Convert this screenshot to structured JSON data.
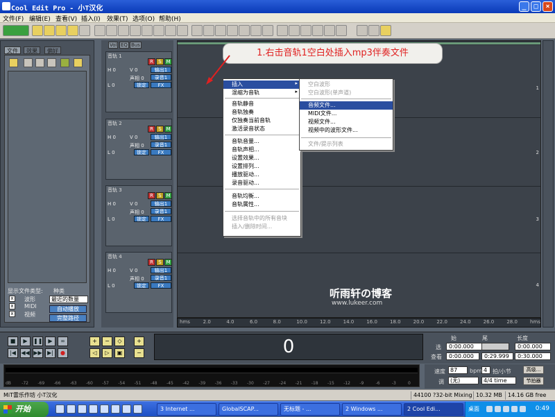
{
  "window": {
    "title": "Cool Edit Pro   - 小T汉化",
    "controls": [
      "_",
      "□",
      "×"
    ]
  },
  "menubar": [
    "文件(F)",
    "编辑(E)",
    "查看(V)",
    "插入(I)",
    "效果(T)",
    "选项(O)",
    "帮助(H)"
  ],
  "left_panel": {
    "tabs": [
      "文件",
      "效果",
      "偏好"
    ],
    "filter_label": "显示文件类型:",
    "filter_types": [
      "波形",
      "MIDI",
      "视频"
    ],
    "sort_label": "种类",
    "sort_value": "最近的数量",
    "btn_auto_play": "自动播放",
    "btn_full_path": "完整路径"
  },
  "track_header": {
    "tabs": [
      "Vol",
      "EQ",
      "Bus"
    ],
    "tracks": [
      {
        "name": "音轨 1",
        "h": "H 0",
        "l": "L 0",
        "v": "V 0",
        "pan": "声相 0",
        "out": "输出1",
        "rec": "录音1",
        "lock": "锁定",
        "fx": "FX"
      },
      {
        "name": "音轨 2",
        "h": "H 0",
        "l": "L 0",
        "v": "V 0",
        "pan": "声相 0",
        "out": "输出1",
        "rec": "录音1",
        "lock": "锁定",
        "fx": "FX"
      },
      {
        "name": "音轨 3",
        "h": "H 0",
        "l": "L 0",
        "v": "V 0",
        "pan": "声相 0",
        "out": "输出1",
        "rec": "录音1",
        "lock": "锁定",
        "fx": "FX"
      },
      {
        "name": "音轨 4",
        "h": "H 0",
        "l": "L 0",
        "v": "V 0",
        "pan": "声相 0",
        "out": "输出1",
        "rec": "录音1",
        "lock": "锁定",
        "fx": "FX"
      }
    ],
    "rsm": [
      "R",
      "S",
      "M"
    ]
  },
  "annotation": "1.右击音轨1空白处插入mp3伴奏文件",
  "context_menu": {
    "items": [
      {
        "label": "插入",
        "submenu": true,
        "highlighted": true
      },
      {
        "label": "混缩为音轨",
        "submenu": true
      },
      {
        "label": "音轨静音"
      },
      {
        "label": "音轨独奏"
      },
      {
        "label": "仅独奏当前音轨"
      },
      {
        "label": "激活录音状态"
      },
      {
        "label": "音轨音量..."
      },
      {
        "label": "音轨声相..."
      },
      {
        "label": "设置效果..."
      },
      {
        "label": "设置排列..."
      },
      {
        "label": "播放驱动..."
      },
      {
        "label": "录音驱动..."
      },
      {
        "label": "音轨均衡..."
      },
      {
        "label": "音轨属性..."
      },
      {
        "label": "选择音轨中的所有音块",
        "disabled": true
      },
      {
        "label": "插入/删除时间...",
        "disabled": true
      }
    ]
  },
  "submenu": {
    "items": [
      {
        "label": "空白波形",
        "disabled": true
      },
      {
        "label": "空白波形(单声道)",
        "disabled": true
      },
      {
        "label": "音频文件...",
        "highlighted": true
      },
      {
        "label": "MIDI文件..."
      },
      {
        "label": "视频文件..."
      },
      {
        "label": "视频中的波形文件..."
      },
      {
        "label": "文件/提示列表",
        "disabled": true
      }
    ]
  },
  "watermark": {
    "title": "听雨轩の博客",
    "url": "www.lukeer.com"
  },
  "ruler": [
    "hms",
    "2.0",
    "4.0",
    "6.0",
    "8.0",
    "10.0",
    "12.0",
    "14.0",
    "16.0",
    "18.0",
    "20.0",
    "22.0",
    "24.0",
    "26.0",
    "28.0",
    "hms"
  ],
  "lane_numbers": [
    "1",
    "2",
    "3",
    "4"
  ],
  "transport": {
    "time_display": "0",
    "headers": [
      "始",
      "尾",
      "长度"
    ],
    "row_select": {
      "label": "选",
      "start": "0:00.000",
      "end": "",
      "length": "0:00.000"
    },
    "row_view": {
      "label": "查看",
      "start": "0:00.000",
      "end": "0:29.999",
      "length": "0:30.000"
    }
  },
  "levels": [
    "dB",
    "-72",
    "-69",
    "-66",
    "-63",
    "-60",
    "-57",
    "-54",
    "-51",
    "-48",
    "-45",
    "-42",
    "-39",
    "-36",
    "-33",
    "-30",
    "-27",
    "-24",
    "-21",
    "-18",
    "-15",
    "-12",
    "-9",
    "-6",
    "-3",
    "0"
  ],
  "speed_panel": {
    "speed_label": "速度",
    "speed_value": "87",
    "bpm": "bpm,",
    "beats_value": "4",
    "beats_label": "拍/小节",
    "advanced_btn": "高级...",
    "key_label": "调",
    "key_value": "(无)",
    "time_sig": "4/4 time",
    "metronome_btn": "节拍器"
  },
  "statusbar": {
    "left": "MiT雷乐作坊 小T汉化",
    "format": "44100 ?32-bit Mixing",
    "size": "10.32 MB",
    "free": "14.16 GB free"
  },
  "taskbar": {
    "start": "开始",
    "items": [
      "3 Internet ...",
      "GlobalSCAP...",
      "无标题 - ...",
      "2 Windows ...",
      "2 Cool Edi..."
    ],
    "desktop_label": "桌面",
    "clock": "0:49"
  }
}
